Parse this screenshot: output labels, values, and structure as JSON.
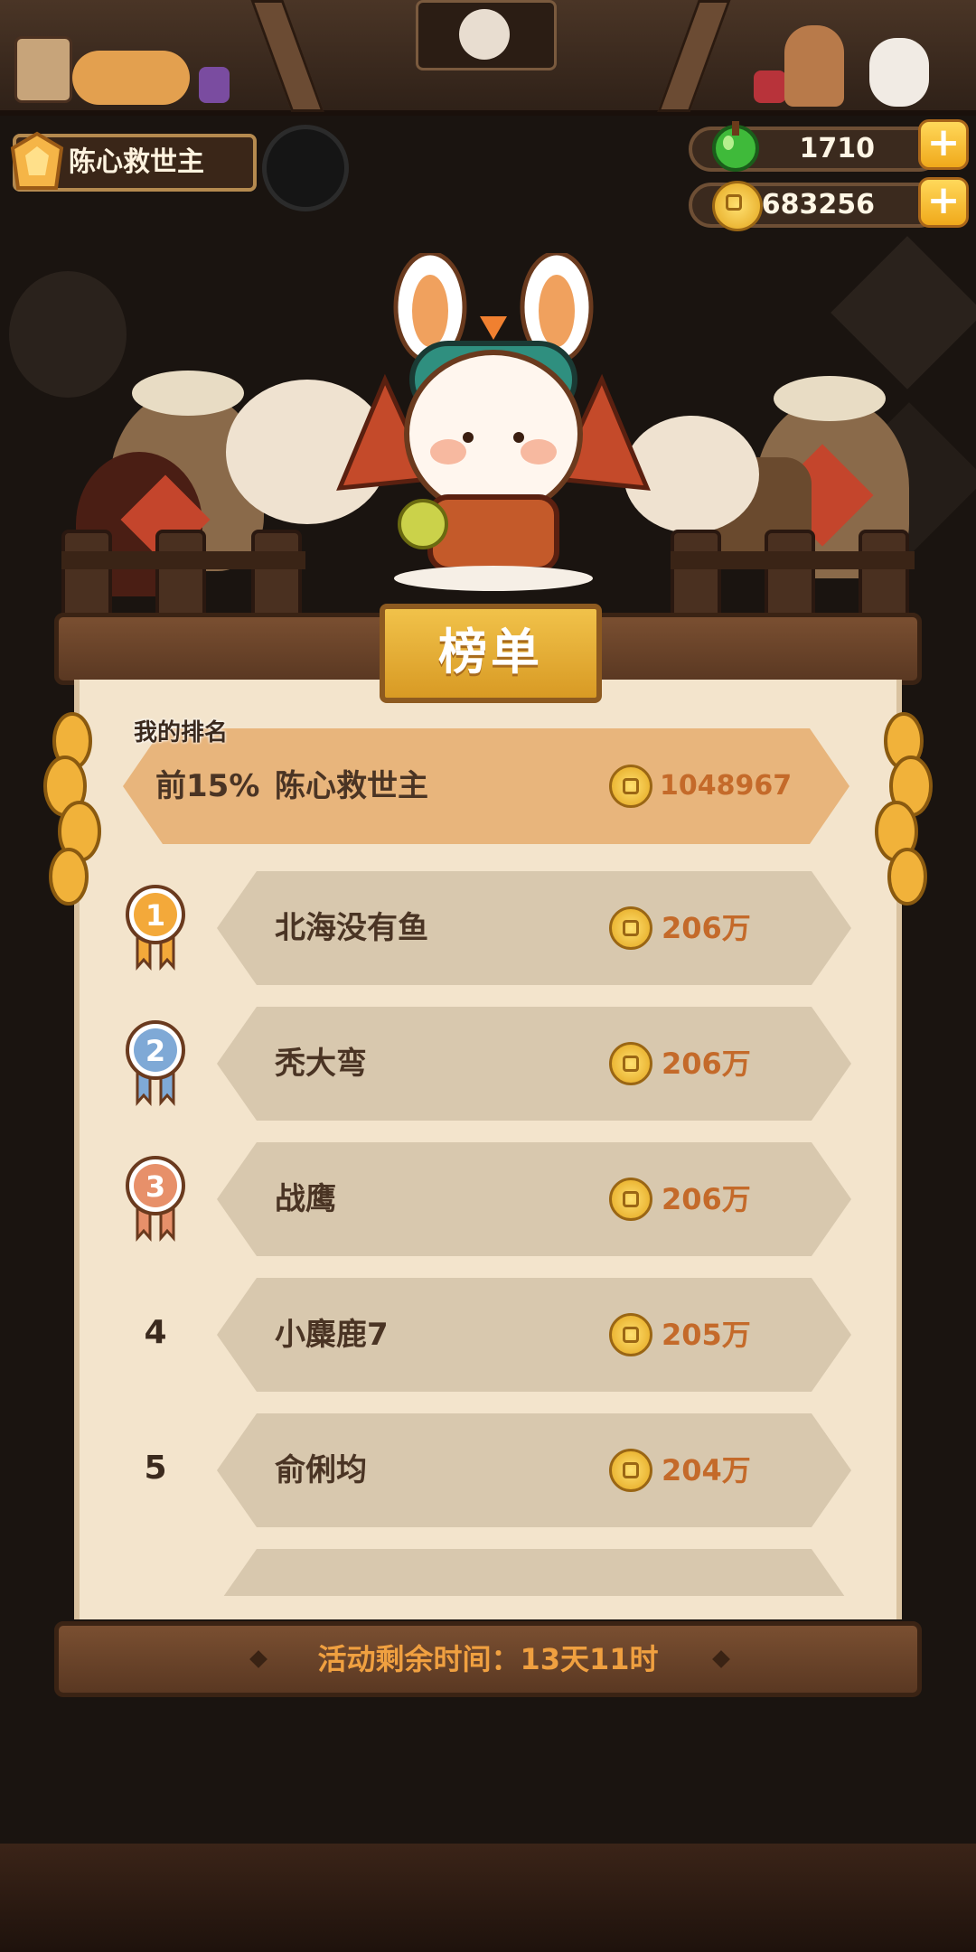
{
  "player": {
    "name": "陈心救世主"
  },
  "currency": {
    "gems": "1710",
    "coins": "4683256",
    "plus_label": "+"
  },
  "leaderboard": {
    "title": "榜单",
    "my_rank_label": "我的排名",
    "my_rank": {
      "rank": "前15%",
      "name": "陈心救世主",
      "score": "1048967"
    },
    "entries": [
      {
        "rank": "1",
        "name": "北海没有鱼",
        "score": "206万",
        "medal": "gold"
      },
      {
        "rank": "2",
        "name": "秃大弯",
        "score": "206万",
        "medal": "silver"
      },
      {
        "rank": "3",
        "name": "战鹰",
        "score": "206万",
        "medal": "bronze"
      },
      {
        "rank": "4",
        "name": "小麋鹿7",
        "score": "205万",
        "medal": ""
      },
      {
        "rank": "5",
        "name": "俞俐均",
        "score": "204万",
        "medal": ""
      }
    ],
    "timer": "活动剩余时间：13天11时"
  },
  "colors": {
    "gold_medal": "#f3a93a",
    "silver_medal": "#7fa9d6",
    "bronze_medal": "#e7906a",
    "score": "#c46a2a"
  },
  "icons": [
    "gem-icon",
    "coin-icon",
    "plus-icon",
    "medal-icon",
    "carrot-icon",
    "bunny-mascot"
  ]
}
